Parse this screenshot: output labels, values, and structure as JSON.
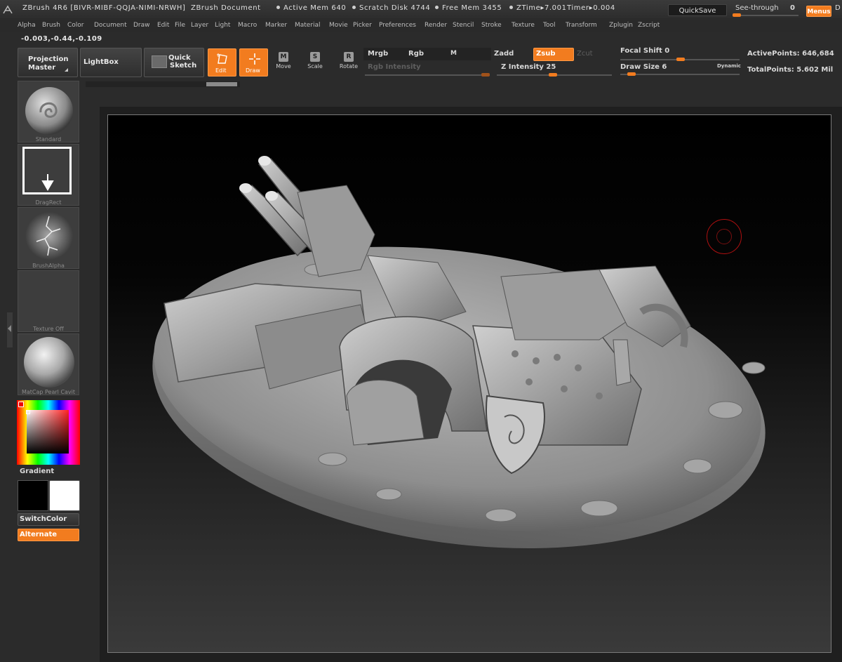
{
  "titlebar": {
    "app_title": "ZBrush 4R6 [BIVR-MIBF-QQJA-NIMI-NRWH]",
    "doc_title": "ZBrush Document",
    "active_mem": "Active Mem 640",
    "scratch_disk": "Scratch Disk 4744",
    "free_mem": "Free Mem 3455",
    "ztime": "ZTime▸7.001",
    "timer": "Timer▸0.004",
    "quicksave_label": "QuickSave",
    "seethrough_label": "See-through",
    "seethrough_value": "0",
    "menus_label": "Menus",
    "extra_label": "D"
  },
  "menubar": {
    "items": [
      "Alpha",
      "Brush",
      "Color",
      "Document",
      "Draw",
      "Edit",
      "File",
      "Layer",
      "Light",
      "Macro",
      "Marker",
      "Material",
      "Movie",
      "Picker",
      "Preferences",
      "Render",
      "Stencil",
      "Stroke",
      "Texture",
      "Tool",
      "Transform",
      "Zplugin",
      "Zscript"
    ]
  },
  "coords": "-0.003,-0.44,-0.109",
  "toolbar": {
    "projection_master": [
      "Projection",
      "Master"
    ],
    "lightbox": "LightBox",
    "quick_sketch": [
      "Quick",
      "Sketch"
    ],
    "edit": "Edit",
    "draw": "Draw",
    "move": "Move",
    "scale": "Scale",
    "rotate": "Rotate",
    "move_glyph": "M",
    "scale_glyph": "S",
    "rotate_glyph": "R",
    "mrgb": "Mrgb",
    "rgb": "Rgb",
    "m": "M",
    "rgb_intensity": "Rgb Intensity",
    "zadd": "Zadd",
    "zsub": "Zsub",
    "zcut": "Zcut",
    "z_intensity": "Z Intensity 25",
    "z_intensity_value": 25,
    "focal_shift": "Focal Shift 0",
    "focal_shift_value": 0,
    "draw_size": "Draw Size 6",
    "draw_size_value": 6,
    "dynamic": "Dynamic",
    "active_points": "ActivePoints: 646,684",
    "total_points": "TotalPoints: 5.602 Mil"
  },
  "leftpanel": {
    "brush_label": "Standard",
    "stroke_label": "DragRect",
    "alpha_label": "BrushAlpha",
    "texture_label": "Texture Off",
    "material_label": "MatCap Pearl Cavit",
    "gradient_label": "Gradient",
    "switchcolor_label": "SwitchColor",
    "alternate_label": "Alternate"
  },
  "colors": {
    "accent": "#f27c1f",
    "primary_color": "#000000",
    "secondary_color": "#ffffff"
  }
}
